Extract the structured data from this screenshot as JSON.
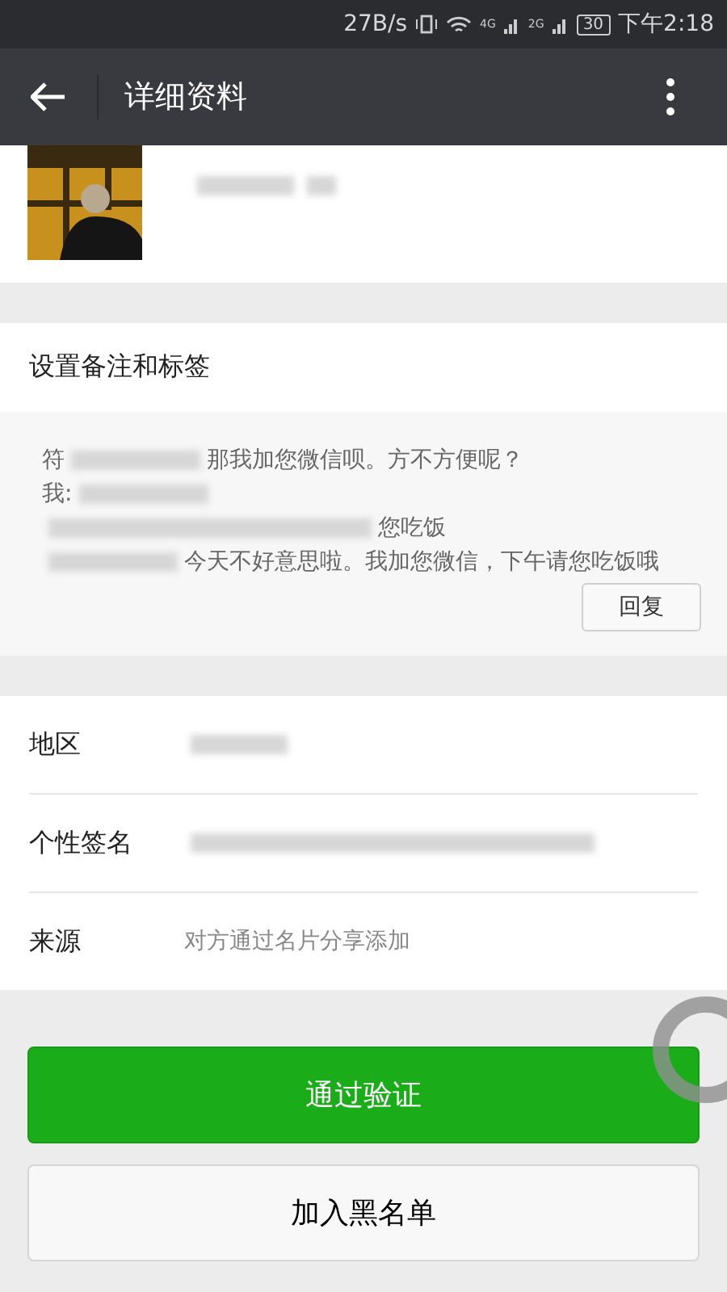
{
  "status_bar": {
    "speed": "27B/s",
    "network_1": "4G",
    "network_2": "2G",
    "battery": "30",
    "time": "下午2:18"
  },
  "toolbar": {
    "title": "详细资料"
  },
  "remark": {
    "label": "设置备注和标签"
  },
  "message": {
    "lines": [
      {
        "prefix": "符",
        "text": "那我加您微信呗。方不方便呢？"
      },
      {
        "prefix": "我:"
      },
      {
        "text": "您吃饭"
      },
      {
        "text": "今天不好意思啦。我加您微信，下午请您吃饭哦"
      }
    ],
    "reply_button": "回复"
  },
  "rows": [
    {
      "label": "地区",
      "redacted": true
    },
    {
      "label": "个性签名",
      "redacted": true
    },
    {
      "label": "来源",
      "value": "对方通过名片分享添加",
      "redacted": false
    }
  ],
  "buttons": [
    {
      "label": "通过验证",
      "kind": "primary"
    },
    {
      "label": "加入黑名单",
      "kind": "secondary"
    }
  ]
}
